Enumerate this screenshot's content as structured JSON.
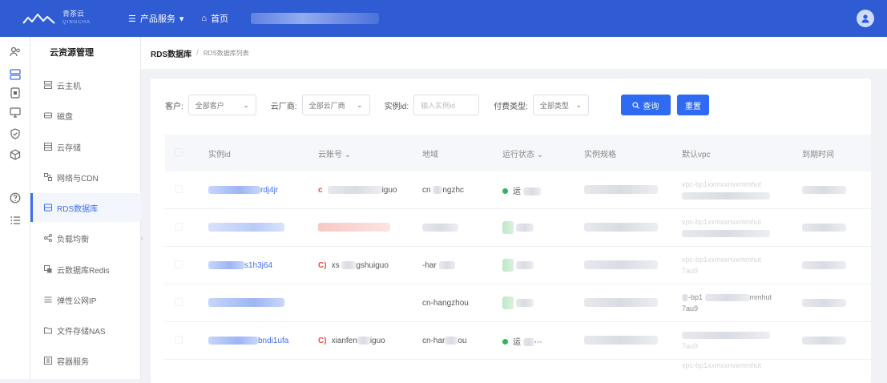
{
  "header": {
    "logo_name": "青茶云",
    "logo_sub": "QINGCHA",
    "nav": [
      {
        "label": "产品服务",
        "icon": "menu-icon",
        "caret": "▾"
      },
      {
        "label": "首页",
        "icon": "home-icon"
      }
    ]
  },
  "sidebar": {
    "title": "云资源管理",
    "items": [
      {
        "label": "云主机",
        "icon": "server-icon"
      },
      {
        "label": "磁盘",
        "icon": "disk-icon"
      },
      {
        "label": "云存储",
        "icon": "storage-icon"
      },
      {
        "label": "网络与CDN",
        "icon": "network-icon"
      },
      {
        "label": "RDS数据库",
        "icon": "database-icon",
        "active": true
      },
      {
        "label": "负载均衡",
        "icon": "share-icon"
      },
      {
        "label": "云数据库Redis",
        "icon": "redis-icon"
      },
      {
        "label": "弹性公网IP",
        "icon": "ip-icon"
      },
      {
        "label": "文件存储NAS",
        "icon": "folder-icon"
      },
      {
        "label": "容器服务",
        "icon": "container-icon"
      }
    ],
    "collapse_glyph": "‹"
  },
  "breadcrumb": {
    "root": "RDS数据库",
    "separator": "/",
    "current": "RDS数据库列表"
  },
  "filters": {
    "customer_label": "客户:",
    "customer_value": "全部客户",
    "vendor_label": "云厂商:",
    "vendor_value": "全部云厂商",
    "instance_label": "实例id:",
    "instance_placeholder": "输入实例id",
    "pay_label": "付费类型:",
    "pay_value": "全部类型",
    "query_button": "查询",
    "reset_button": "重置"
  },
  "table": {
    "columns": [
      "实例id",
      "云账号",
      "地域",
      "运行状态",
      "实例规格",
      "默认vpc",
      "到期时间"
    ],
    "rows": [
      {
        "id": "rdj4jr",
        "account_tag": "c",
        "account": "iguo",
        "region_a": "cn",
        "region_b": "ngzhc",
        "status": "运",
        "vpc": "vpc-bp1xxmxxnvxmmhut"
      },
      {
        "id": "",
        "account_tag": "",
        "account": "",
        "region_a": "",
        "region_b": "",
        "status": "",
        "vpc": "vpc-bp1xxmxxnvxmmhut"
      },
      {
        "id": "s1h3j64",
        "account_tag": "C)",
        "account_a": "xs",
        "account": "gshuiguo",
        "region_a": "-har",
        "region_b": "",
        "status": "",
        "vpc": "vpc-bp1xxmxxnvxmmhut",
        "vpc2": "7au9"
      },
      {
        "id": "",
        "account_tag": "",
        "account": "",
        "region": "cn-hangzhou",
        "status": "",
        "vpc": "-bp1",
        "vpc_tail": "mmhut",
        "vpc2": "7au9"
      },
      {
        "id": "bndi1ufa",
        "account_tag": "C)",
        "account_a": "xianfen",
        "account": "iguo",
        "region_a": "cn-har",
        "region_b": "ou",
        "status": "运",
        "status_tail": "⋯",
        "vpc2": "7au9"
      },
      {
        "vpc": "vpc-bp1xxmxxnvxmmhut"
      }
    ]
  },
  "colors": {
    "header_bg": "#2f5bd3",
    "accent": "#3e6ef0",
    "status_running": "#2fb65a",
    "account_tag": "#e0533f"
  }
}
